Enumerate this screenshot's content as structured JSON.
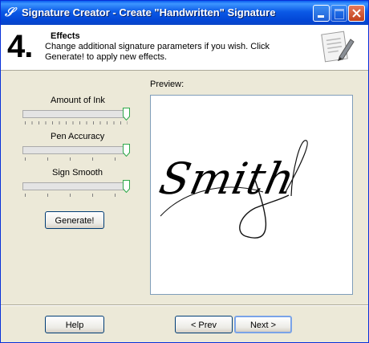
{
  "window": {
    "title": "Signature Creator - Create \"Handwritten\" Signature"
  },
  "header": {
    "step_number": "4.",
    "title": "Effects",
    "description": "Change additional signature parameters if you wish. Click Generate! to apply new effects."
  },
  "controls": {
    "ink": {
      "label": "Amount of Ink",
      "value": 1.0
    },
    "accuracy": {
      "label": "Pen Accuracy",
      "value": 1.0
    },
    "smooth": {
      "label": "Sign Smooth",
      "value": 1.0
    },
    "generate_label": "Generate!"
  },
  "preview": {
    "label": "Preview:",
    "signature_text": "Smith"
  },
  "footer": {
    "help_label": "Help",
    "prev_label": "< Prev",
    "next_label": "Next >"
  },
  "colors": {
    "titlebar": "#0A5FEF",
    "face": "#ECE9D8",
    "thumb": "#2EA94A"
  },
  "icons": {
    "app": "signature-script-icon",
    "header": "document-pen-icon"
  }
}
